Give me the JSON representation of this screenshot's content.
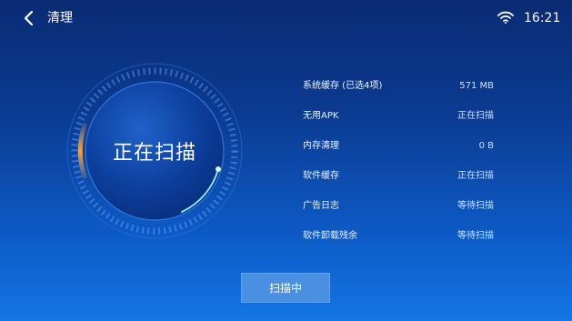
{
  "header": {
    "back_icon": "chevron-left-icon",
    "title": "清理",
    "wifi_icon": "wifi-icon",
    "time": "16:21"
  },
  "scan": {
    "status_text": "正在扫描",
    "button_label": "扫描中"
  },
  "items": [
    {
      "label": "系统缓存 (已选4项)",
      "value": "571 MB"
    },
    {
      "label": "无用APK",
      "value": "正在扫描"
    },
    {
      "label": "内存清理",
      "value": "0 B"
    },
    {
      "label": "软件缓存",
      "value": "正在扫描"
    },
    {
      "label": "广告日志",
      "value": "等待扫描"
    },
    {
      "label": "软件卸载残余",
      "value": "等待扫描"
    }
  ],
  "colors": {
    "accent_orange": "#f5a14a",
    "accent_cyan": "#7fe6ff",
    "button_bg": "#4a90e2"
  }
}
